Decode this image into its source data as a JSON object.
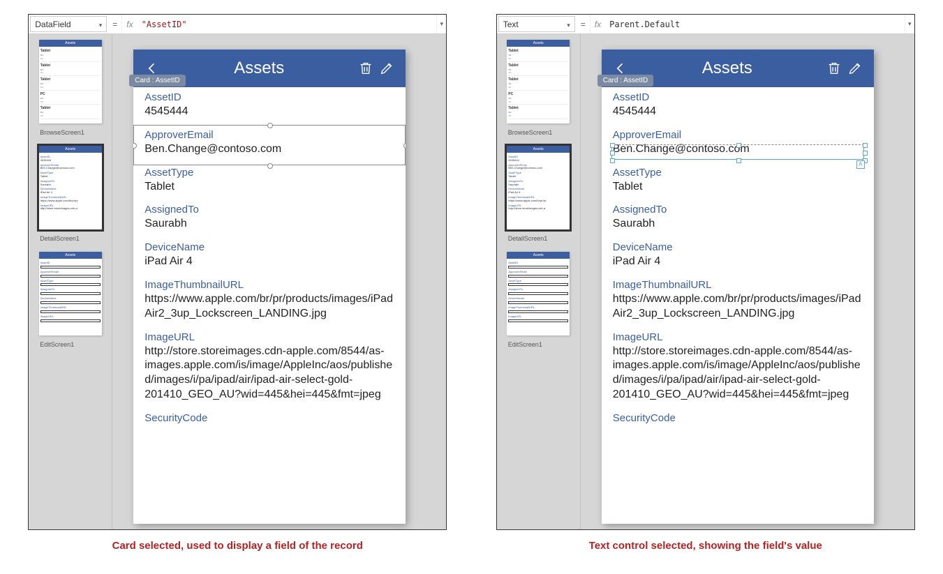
{
  "panels": {
    "left": {
      "property": "DataField",
      "formula": "\"AssetID\"",
      "formula_is_string": true,
      "caption": "Card selected, used to display a field of the record",
      "selection_mode": "card"
    },
    "right": {
      "property": "Text",
      "formula": "Parent.Default",
      "formula_is_string": false,
      "caption": "Text control selected, showing the field's value",
      "selection_mode": "text"
    }
  },
  "common": {
    "eq": "=",
    "fx": "fx",
    "card_tag": "Card : AssetID",
    "app_title": "Assets",
    "sel_badge": "A"
  },
  "thumbs": [
    {
      "name": "BrowseScreen1",
      "type": "browse"
    },
    {
      "name": "DetailScreen1",
      "type": "detail",
      "selected": true
    },
    {
      "name": "EditScreen1",
      "type": "edit"
    }
  ],
  "browse_items": [
    "Tablet",
    "Tablet",
    "Tablet",
    "PC",
    "Tablet"
  ],
  "fields": [
    {
      "label": "AssetID",
      "value": "4545444"
    },
    {
      "label": "ApproverEmail",
      "value": "Ben.Change@contoso.com"
    },
    {
      "label": "AssetType",
      "value": "Tablet"
    },
    {
      "label": "AssignedTo",
      "value": "Saurabh"
    },
    {
      "label": "DeviceName",
      "value": "iPad Air 4"
    },
    {
      "label": "ImageThumbnailURL",
      "value": "https://www.apple.com/br/pr/products/images/iPadAir2_3up_Lockscreen_LANDING.jpg"
    },
    {
      "label": "ImageURL",
      "value": "http://store.storeimages.cdn-apple.com/8544/as-images.apple.com/is/image/AppleInc/aos/published/images/i/pa/ipad/air/ipad-air-select-gold-201410_GEO_AU?wid=445&hei=445&fmt=jpeg"
    },
    {
      "label": "SecurityCode",
      "value": ""
    }
  ]
}
